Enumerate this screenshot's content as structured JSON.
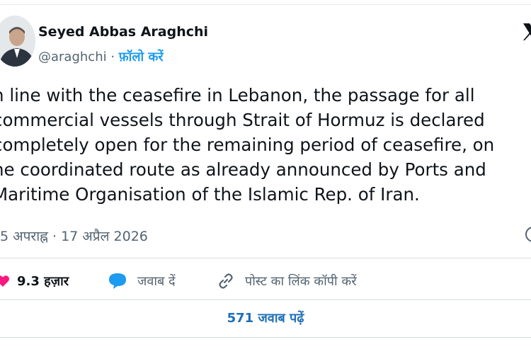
{
  "author": {
    "name": "Seyed Abbas Araghchi",
    "handle": "@araghchi",
    "separator": " · ",
    "follow_label": "फ़ॉलो करें"
  },
  "tweet": {
    "lines": [
      "n line with the ceasefire in Lebanon, the passage for all",
      "commercial vessels through Strait of Hormuz is declared",
      "completely open for the remaining period of ceasefire, on",
      "he coordinated route as already announced by Ports and",
      "Maritime Organisation of the Islamic Rep. of Iran."
    ],
    "timestamp": "5 अपराह्न · 17 अप्रैल 2026"
  },
  "actions": {
    "like_count": "9.3 हज़ार",
    "reply_label": "जवाब दें",
    "copy_link_label": "पोस्ट का लिंक कॉपी करें"
  },
  "read_replies_label": "571 जवाब पढ़ें",
  "colors": {
    "like": "#f91880",
    "reply": "#1d9bf0",
    "link": "#1d6fb8",
    "muted": "#536471",
    "text": "#0f1419"
  },
  "icons": {
    "platform": "x-logo-icon",
    "like": "heart-icon",
    "reply": "speech-bubble-icon",
    "copy": "link-icon",
    "info": "info-icon"
  }
}
